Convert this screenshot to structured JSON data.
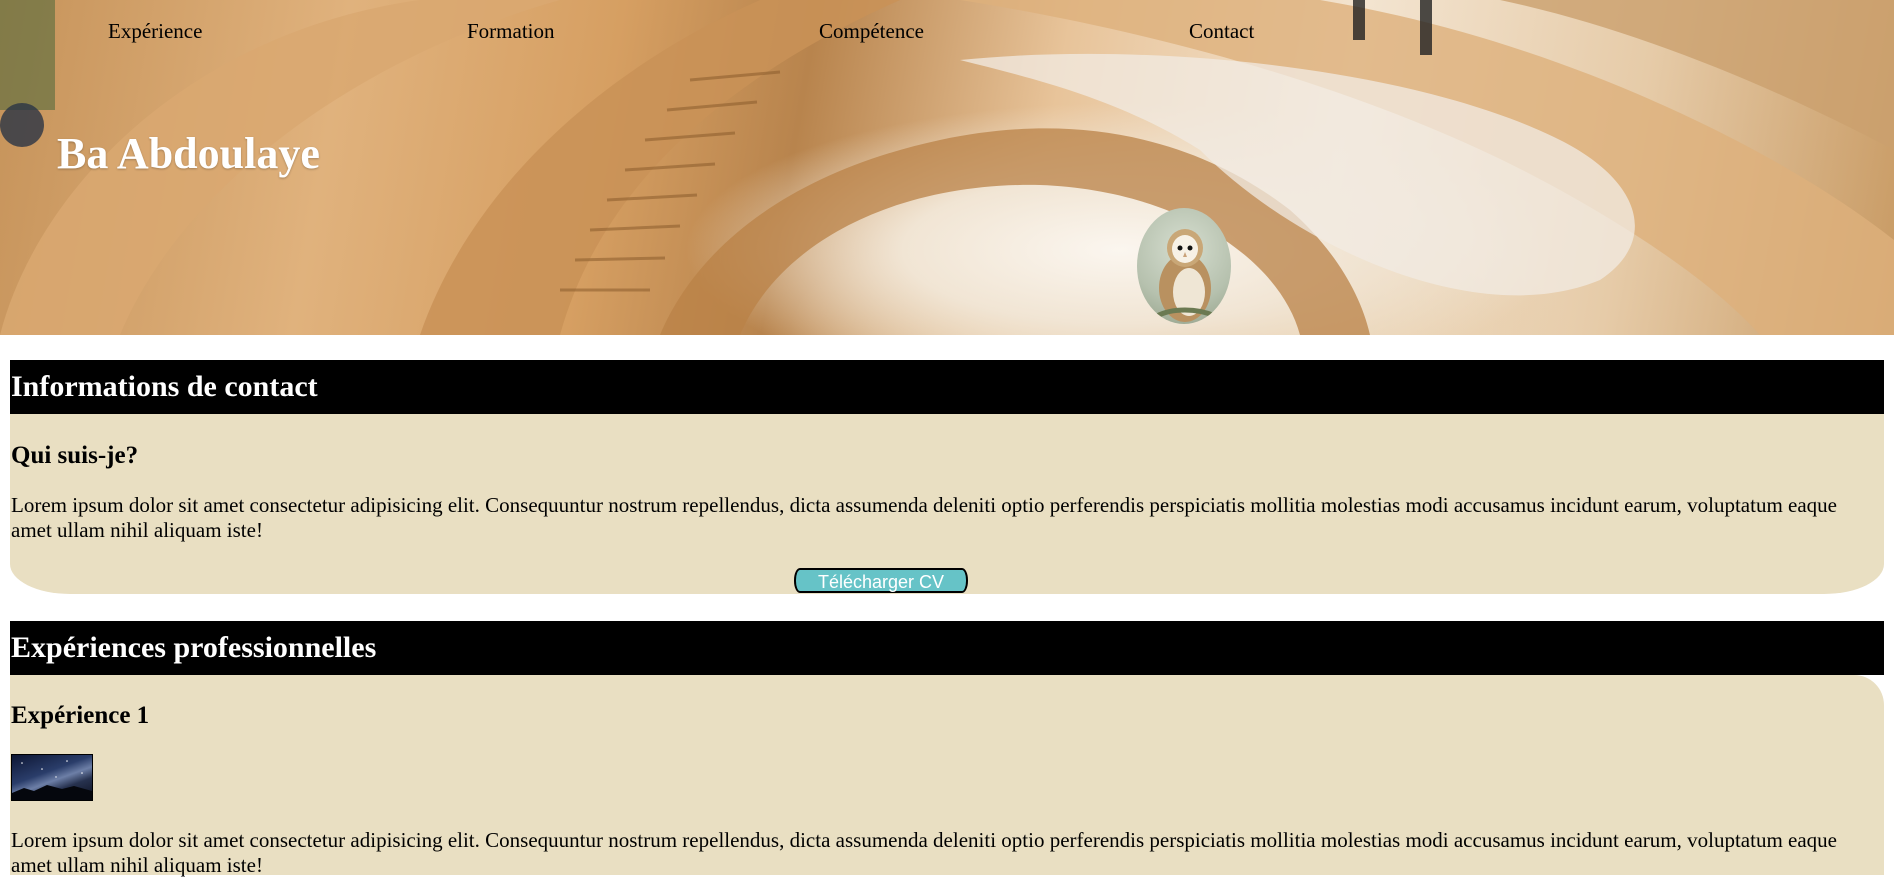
{
  "nav": {
    "items": [
      "Expérience",
      "Formation",
      "Compétence",
      "Contact"
    ]
  },
  "header": {
    "name": "Ba Abdoulaye"
  },
  "contact_section": {
    "title": "Informations de contact",
    "subtitle": "Qui suis-je?",
    "text": "Lorem ipsum dolor sit amet consectetur adipisicing elit. Consequuntur nostrum repellendus, dicta assumenda deleniti optio perferendis perspiciatis mollitia molestias modi accusamus incidunt earum, voluptatum eaque amet ullam nihil aliquam iste!",
    "button_label": "Télécharger CV"
  },
  "experience_section": {
    "title": "Expériences professionnelles",
    "item_title": "Expérience 1",
    "text": "Lorem ipsum dolor sit amet consectetur adipisicing elit. Consequuntur nostrum repellendus, dicta assumenda deleniti optio perferendis perspiciatis mollitia molestias modi accusamus incidunt earum, voluptatum eaque amet ullam nihil aliquam iste!"
  },
  "colors": {
    "section_bar": "#000000",
    "section_body": "#e9dfc2",
    "button": "#66c3c7"
  }
}
